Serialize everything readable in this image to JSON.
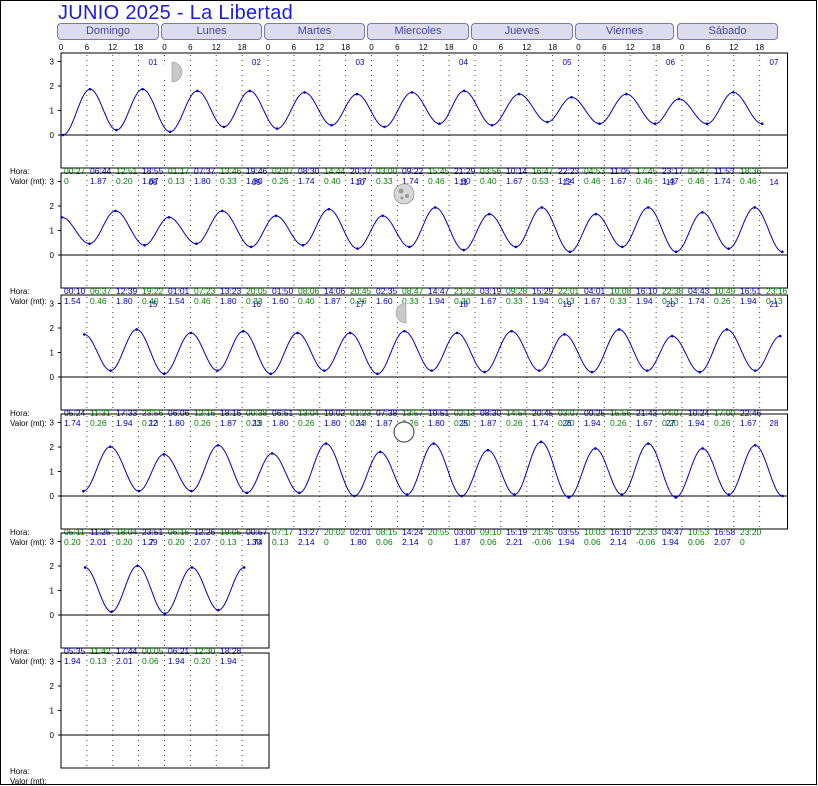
{
  "title": "JUNIO 2025 - La Libertad",
  "day_headers": [
    "Domingo",
    "Lunes",
    "Martes",
    "Miercoles",
    "Jueves",
    "Viernes",
    "Sábado"
  ],
  "hour_ticks": [
    "0",
    "6",
    "12",
    "18"
  ],
  "row_labels": {
    "hora": "Hora:",
    "valor": "Valor (mt):"
  },
  "colors": {
    "curve": "#0000cc",
    "high": "#0000cc",
    "low": "#008800",
    "title": "#1a1aee"
  },
  "moon_phases": [
    {
      "day": "01",
      "phase": "first-quarter"
    },
    {
      "day": "11",
      "phase": "full"
    },
    {
      "day": "18",
      "phase": "last-quarter"
    },
    {
      "day": "25",
      "phase": "new"
    }
  ],
  "chart_data": {
    "type": "line",
    "title": "JUNIO 2025 - La Libertad",
    "xlabel": "",
    "ylabel": "",
    "ylim": [
      -0.2,
      3.2
    ],
    "y_ticks": [
      "0",
      "1",
      "2",
      "3"
    ],
    "weeks": [
      {
        "first_day": 0,
        "days": [
          "01",
          "02",
          "03",
          "04",
          "05",
          "06",
          "07"
        ],
        "extremes": [
          {
            "t": "00:27",
            "v": "0"
          },
          {
            "t": "06:44",
            "v": "1.87"
          },
          {
            "t": "12:51",
            "v": "0.20"
          },
          {
            "t": "18:55",
            "v": "1.87"
          },
          {
            "t": "01:17",
            "v": "0.13"
          },
          {
            "t": "07:37",
            "v": "1.80"
          },
          {
            "t": "13:46",
            "v": "0.33"
          },
          {
            "t": "19:46",
            "v": "1.80"
          },
          {
            "t": "02:07",
            "v": "0.26"
          },
          {
            "t": "08:30",
            "v": "1.74"
          },
          {
            "t": "14:44",
            "v": "0.40"
          },
          {
            "t": "20:37",
            "v": "1.67"
          },
          {
            "t": "03:00",
            "v": "0.33"
          },
          {
            "t": "09:22",
            "v": "1.74"
          },
          {
            "t": "15:45",
            "v": "0.46"
          },
          {
            "t": "21:29",
            "v": "1.80"
          },
          {
            "t": "03:56",
            "v": "0.40"
          },
          {
            "t": "10:14",
            "v": "1.67"
          },
          {
            "t": "16:47",
            "v": "0.53"
          },
          {
            "t": "22:23",
            "v": "1.54"
          },
          {
            "t": "04:53",
            "v": "0.46"
          },
          {
            "t": "11:05",
            "v": "1.67"
          },
          {
            "t": "17:45",
            "v": "0.46"
          },
          {
            "t": "23:17",
            "v": "1.47"
          },
          {
            "t": "05:47",
            "v": "0.46"
          },
          {
            "t": "11:53",
            "v": "1.74"
          },
          {
            "t": "18:36",
            "v": "0.46"
          }
        ]
      },
      {
        "first_day": 7,
        "days": [
          "08",
          "09",
          "10",
          "11",
          "12",
          "13",
          "14"
        ],
        "extremes": [
          {
            "t": "00:10",
            "v": "1.54"
          },
          {
            "t": "06:37",
            "v": "0.46"
          },
          {
            "t": "12:39",
            "v": "1.80"
          },
          {
            "t": "19:22",
            "v": "0.40"
          },
          {
            "t": "01:01",
            "v": "1.54"
          },
          {
            "t": "07:23",
            "v": "0.46"
          },
          {
            "t": "13:23",
            "v": "1.80"
          },
          {
            "t": "20:05",
            "v": "0.33"
          },
          {
            "t": "01:50",
            "v": "1.60"
          },
          {
            "t": "08:06",
            "v": "0.40"
          },
          {
            "t": "14:06",
            "v": "1.87"
          },
          {
            "t": "20:45",
            "v": "0.26"
          },
          {
            "t": "02:35",
            "v": "1.60"
          },
          {
            "t": "08:47",
            "v": "0.33"
          },
          {
            "t": "14:47",
            "v": "1.94"
          },
          {
            "t": "21:23",
            "v": "0.20"
          },
          {
            "t": "03:19",
            "v": "1.67"
          },
          {
            "t": "09:28",
            "v": "0.33"
          },
          {
            "t": "15:29",
            "v": "1.94"
          },
          {
            "t": "22:01",
            "v": "0.13"
          },
          {
            "t": "04:01",
            "v": "1.67"
          },
          {
            "t": "10:08",
            "v": "0.33"
          },
          {
            "t": "16:10",
            "v": "1.94"
          },
          {
            "t": "22:38",
            "v": "0.13"
          },
          {
            "t": "04:43",
            "v": "1.74"
          },
          {
            "t": "10:49",
            "v": "0.26"
          },
          {
            "t": "16:51",
            "v": "1.94"
          },
          {
            "t": "23:16",
            "v": "0.13"
          }
        ]
      },
      {
        "first_day": 14,
        "days": [
          "15",
          "16",
          "17",
          "18",
          "19",
          "20",
          "21"
        ],
        "extremes": [
          {
            "t": "05:24",
            "v": "1.74"
          },
          {
            "t": "11:31",
            "v": "0.26"
          },
          {
            "t": "17:33",
            "v": "1.94"
          },
          {
            "t": "23:56",
            "v": "0.13"
          },
          {
            "t": "06:06",
            "v": "1.80"
          },
          {
            "t": "12:16",
            "v": "0.26"
          },
          {
            "t": "18:16",
            "v": "1.87"
          },
          {
            "t": "00:38",
            "v": "0.13"
          },
          {
            "t": "06:51",
            "v": "1.80"
          },
          {
            "t": "13:04",
            "v": "0.26"
          },
          {
            "t": "19:02",
            "v": "1.80"
          },
          {
            "t": "01:23",
            "v": "0.13"
          },
          {
            "t": "07:38",
            "v": "1.87"
          },
          {
            "t": "13:57",
            "v": "0.26"
          },
          {
            "t": "19:51",
            "v": "1.80"
          },
          {
            "t": "02:13",
            "v": "0.20"
          },
          {
            "t": "08:30",
            "v": "1.87"
          },
          {
            "t": "14:54",
            "v": "0.26"
          },
          {
            "t": "20:45",
            "v": "1.74"
          },
          {
            "t": "03:07",
            "v": "0.20"
          },
          {
            "t": "09:25",
            "v": "1.94"
          },
          {
            "t": "15:56",
            "v": "0.26"
          },
          {
            "t": "21:43",
            "v": "1.67"
          },
          {
            "t": "04:07",
            "v": "0.20"
          },
          {
            "t": "10:24",
            "v": "1.94"
          },
          {
            "t": "17:00",
            "v": "0.26"
          },
          {
            "t": "22:46",
            "v": "1.67"
          }
        ]
      },
      {
        "first_day": 21,
        "days": [
          "22",
          "23",
          "24",
          "25",
          "26",
          "27",
          "28"
        ],
        "extremes": [
          {
            "t": "05:11",
            "v": "0.20"
          },
          {
            "t": "11:25",
            "v": "2.01"
          },
          {
            "t": "18:04",
            "v": "0.20"
          },
          {
            "t": "23:51",
            "v": "1.7"
          },
          {
            "t": "06:15",
            "v": "0.20"
          },
          {
            "t": "12:26",
            "v": "2.07"
          },
          {
            "t": "19:05",
            "v": "0.13"
          },
          {
            "t": "00:57",
            "v": "1.74"
          },
          {
            "t": "07:17",
            "v": "0.13"
          },
          {
            "t": "13:27",
            "v": "2.14"
          },
          {
            "t": "20:02",
            "v": "0"
          },
          {
            "t": "02:01",
            "v": "1.80"
          },
          {
            "t": "08:15",
            "v": "0.06"
          },
          {
            "t": "14:24",
            "v": "2.14"
          },
          {
            "t": "20:55",
            "v": "0"
          },
          {
            "t": "03:00",
            "v": "1.87"
          },
          {
            "t": "09:10",
            "v": "0.06"
          },
          {
            "t": "15:19",
            "v": "2.21"
          },
          {
            "t": "21:45",
            "v": "-0.06"
          },
          {
            "t": "03:55",
            "v": "1.94"
          },
          {
            "t": "10:03",
            "v": "0.06"
          },
          {
            "t": "16:10",
            "v": "2.14"
          },
          {
            "t": "22:33",
            "v": "-0.06"
          },
          {
            "t": "04:47",
            "v": "1.94"
          },
          {
            "t": "10:53",
            "v": "0.06"
          },
          {
            "t": "16:58",
            "v": "2.07"
          },
          {
            "t": "23:20",
            "v": "0"
          }
        ]
      },
      {
        "first_day": 28,
        "days": [
          "29",
          "30"
        ],
        "extremes": [
          {
            "t": "05:35",
            "v": "1.94"
          },
          {
            "t": "11:42",
            "v": "0.13"
          },
          {
            "t": "17:44",
            "v": "2.01"
          },
          {
            "t": "00:05",
            "v": "0.06"
          },
          {
            "t": "06:21",
            "v": "1.94"
          },
          {
            "t": "12:30",
            "v": "0.20"
          },
          {
            "t": "18:28",
            "v": "1.94"
          }
        ]
      },
      {
        "first_day": 35,
        "days": [],
        "extremes": []
      }
    ]
  }
}
